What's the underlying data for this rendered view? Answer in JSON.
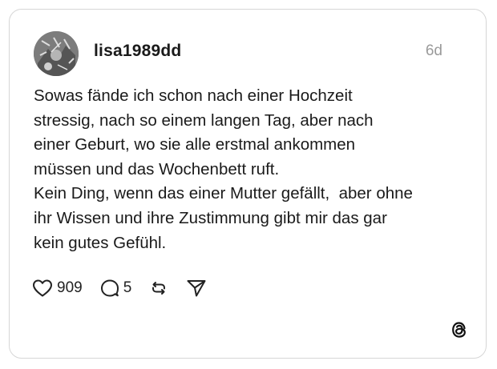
{
  "post": {
    "username": "lisa1989dd",
    "time": "6d",
    "lines": [
      "Sowas fände ich schon nach einer Hochzeit",
      "stressig, nach so einem langen Tag, aber nach",
      "einer Geburt, wo sie alle erstmal ankommen",
      "müssen und das Wochenbett ruft.",
      "Kein Ding, wenn das einer Mutter gefällt,  aber ohne",
      "ihr Wissen und ihre Zustimmung gibt mir das gar",
      "kein gutes Gefühl."
    ]
  },
  "actions": {
    "like_icon": "heart-icon",
    "like_count": "909",
    "reply_icon": "comment-icon",
    "reply_count": "5",
    "repost_icon": "repost-icon",
    "share_icon": "send-icon"
  },
  "brand": {
    "logo_icon": "threads-logo-icon"
  }
}
